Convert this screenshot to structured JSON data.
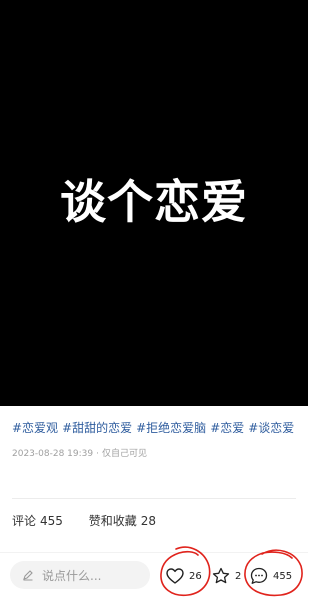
{
  "cover": {
    "title": "谈个恋爱"
  },
  "post": {
    "tags_line": [
      "#恋爱观",
      "#甜甜的恋爱",
      "#拒绝恋爱脑",
      "#恋爱",
      "#谈恋爱"
    ],
    "date": "2023-08-28 19:39",
    "visibility": "仅自己可见"
  },
  "tabs": [
    {
      "label": "评论",
      "count": "455"
    },
    {
      "label": "赞和收藏",
      "count": "28"
    }
  ],
  "bottom_bar": {
    "input_placeholder": "说点什么...",
    "likes": "26",
    "collects": "2",
    "comments": "455"
  },
  "colors": {
    "tag_blue": "#2f5d9e",
    "annotation_red": "#e0231c",
    "cover_bg": "#000000"
  },
  "icons": [
    "pen-icon",
    "heart-icon",
    "star-icon",
    "comment-bubble-icon"
  ]
}
